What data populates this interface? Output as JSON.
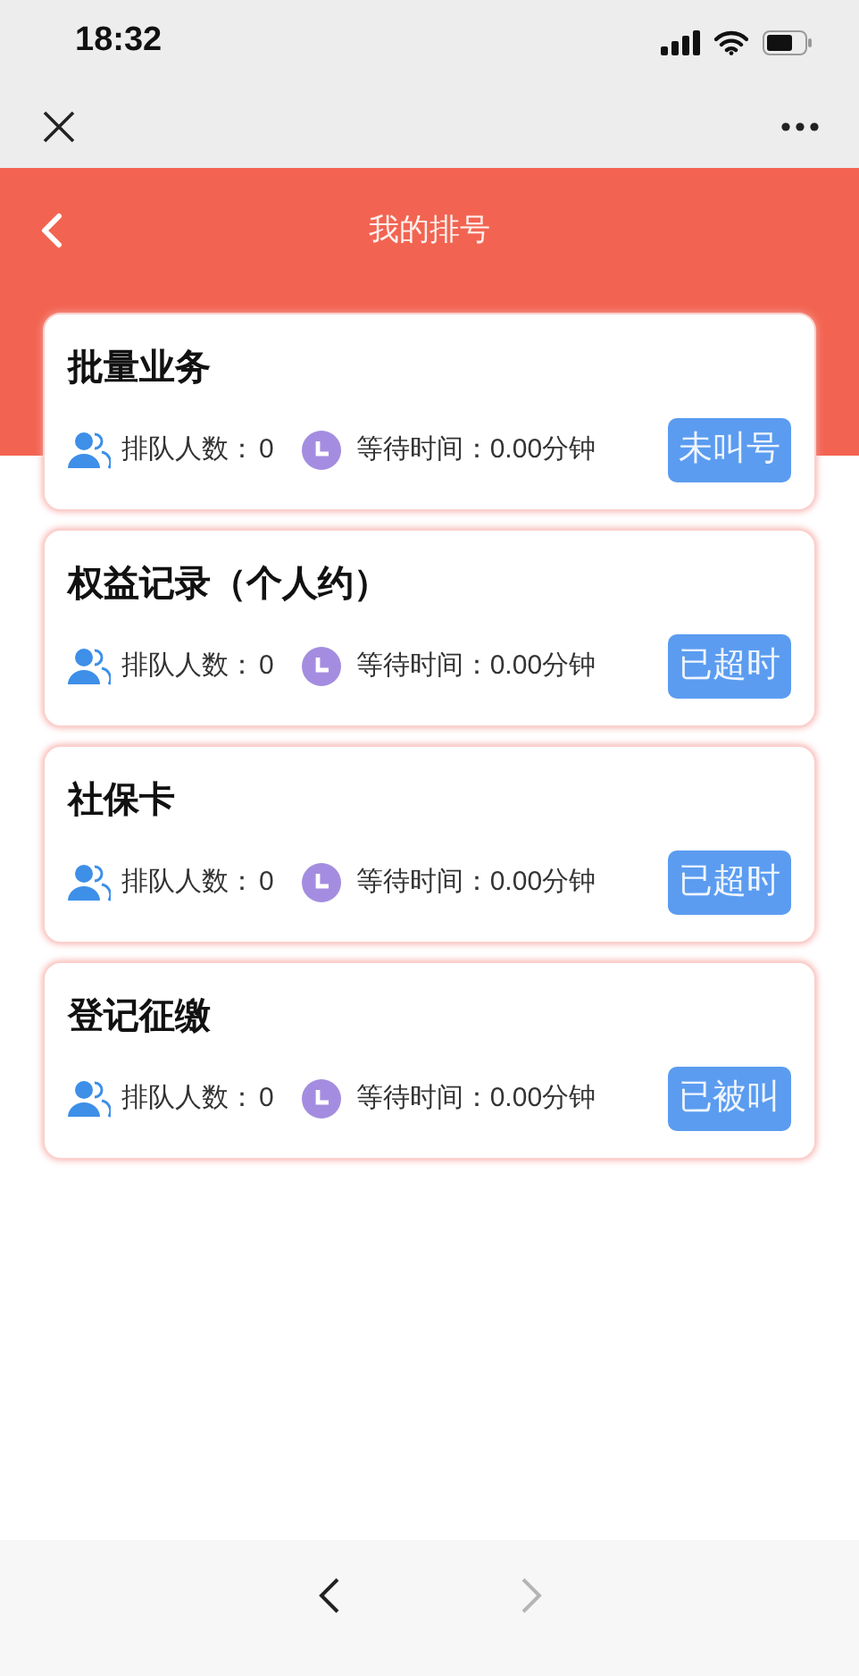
{
  "status_bar": {
    "time": "18:32"
  },
  "header": {
    "title": "我的排号"
  },
  "queue": [
    {
      "title": "批量业务",
      "people_label": "排队人数：",
      "people": "0",
      "wait_label": "等待时间：",
      "wait": "0.00分钟",
      "status": "未叫号"
    },
    {
      "title": "权益记录（个人约）",
      "people_label": "排队人数：",
      "people": "0",
      "wait_label": "等待时间：",
      "wait": "0.00分钟",
      "status": "已超时"
    },
    {
      "title": "社保卡",
      "people_label": "排队人数：",
      "people": "0",
      "wait_label": "等待时间：",
      "wait": "0.00分钟",
      "status": "已超时"
    },
    {
      "title": "登记征缴",
      "people_label": "排队人数：",
      "people": "0",
      "wait_label": "等待时间：",
      "wait": "0.00分钟",
      "status": "已被叫"
    }
  ],
  "bottom_nav": {
    "back_disabled": false,
    "forward_disabled": true
  }
}
